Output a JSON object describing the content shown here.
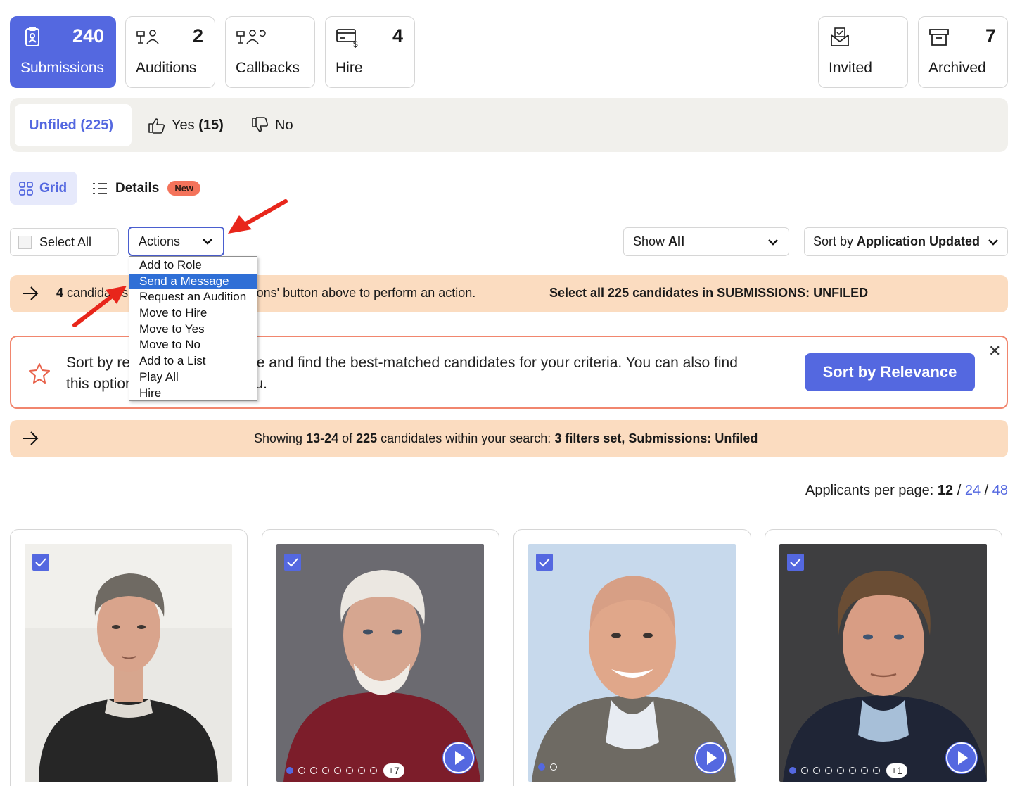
{
  "stages": [
    {
      "label": "Submissions",
      "count": "240",
      "icon": "clipboard-user-icon"
    },
    {
      "label": "Auditions",
      "count": "2",
      "icon": "audition-icon"
    },
    {
      "label": "Callbacks",
      "count": "",
      "icon": "callback-icon"
    },
    {
      "label": "Hire",
      "count": "4",
      "icon": "hire-payment-icon"
    },
    {
      "label": "Invited",
      "count": "",
      "icon": "invite-envelope-icon"
    },
    {
      "label": "Archived",
      "count": "7",
      "icon": "archive-box-icon"
    }
  ],
  "filter_tabs": [
    {
      "label": "Unfiled (225)"
    },
    {
      "label": "Yes",
      "count": "(15)"
    },
    {
      "label": "No"
    }
  ],
  "view": {
    "grid_label": "Grid",
    "details_label": "Details",
    "new_badge": "New"
  },
  "toolbar": {
    "select_all": "Select All",
    "actions": "Actions",
    "show_prefix": "Show",
    "show_value": "All",
    "sort_prefix": "Sort by",
    "sort_value": "Application Updated"
  },
  "actions_menu": {
    "items": [
      "Add to Role",
      "Send a Message",
      "Request an Audition",
      "Move to Hire",
      "Move to Yes",
      "Move to No",
      "Add to a List",
      "Play All",
      "Hire"
    ],
    "selected": "Send a Message"
  },
  "selected_banner": {
    "count": "4",
    "text_before": " candidates selected. Use the 'Actions' button above to perform an action.",
    "link": "Select all 225 candidates in SUBMISSIONS: UNFILED"
  },
  "relevance": {
    "line1": "Sort by relevance to save time and find the best-matched candidates for your criteria. You can also find",
    "line2": "this option in the sort by menu.",
    "button": "Sort by Relevance",
    "close": "✕"
  },
  "showing_banner": {
    "showing": "Showing ",
    "range": "13-24",
    "of": " of ",
    "total": "225",
    "mid": " candidates within your search:  ",
    "filters": "3 filters set",
    "sep": ",  ",
    "scope": "Submissions: Unfiled"
  },
  "per_page": {
    "label": "Applicants per page: ",
    "current": "12",
    "sep": " / ",
    "opt2": "24",
    "opt3": "48"
  },
  "candidates": [
    {
      "dots": 0,
      "more": "",
      "has_play": false
    },
    {
      "dots": 8,
      "more": "+7",
      "has_play": true
    },
    {
      "dots": 2,
      "more": "",
      "has_play": true
    },
    {
      "dots": 8,
      "more": "+1",
      "has_play": true
    }
  ],
  "colors": {
    "accent": "#5468e0",
    "banner": "#fbdcc0",
    "relevance_border": "#f1866e",
    "badge": "#f4735b",
    "annotation_arrow": "#e8261b"
  }
}
